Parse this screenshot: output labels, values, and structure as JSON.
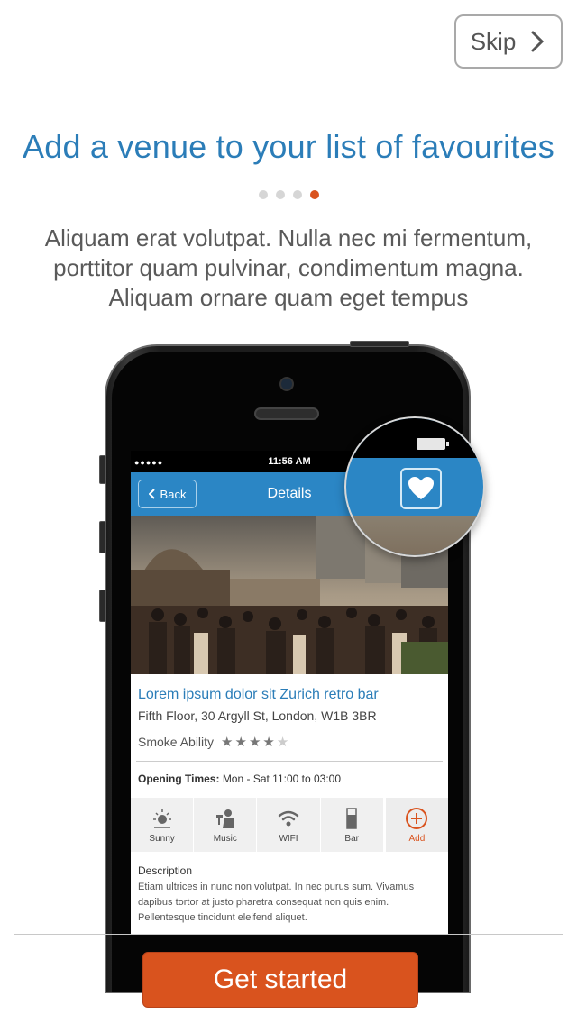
{
  "skip": {
    "label": "Skip"
  },
  "onboarding": {
    "title": "Add a venue to your list of favourites",
    "page_indicator": {
      "total": 4,
      "current": 4
    },
    "description": "Aliquam erat volutpat. Nulla nec mi fermentum, porttitor quam pulvinar, condimentum magna. Aliquam ornare quam eget tempus"
  },
  "phone_screen": {
    "status_bar": {
      "time": "11:56 AM",
      "signal": "●●●●●"
    },
    "nav": {
      "back_label": "Back",
      "title": "Details"
    },
    "venue": {
      "name": "Lorem ipsum dolor sit Zurich retro bar",
      "address": "Fifth Floor, 30 Argyll St, London, W1B 3BR",
      "smoke_label": "Smoke Ability",
      "smoke_rating": 4,
      "smoke_rating_max": 5,
      "opening_label": "Opening Times:",
      "opening_value": "Mon - Sat 11:00 to 03:00"
    },
    "amenities": [
      {
        "label": "Sunny",
        "icon": "sun-icon"
      },
      {
        "label": "Music",
        "icon": "music-icon"
      },
      {
        "label": "WIFI",
        "icon": "wifi-icon"
      },
      {
        "label": "Bar",
        "icon": "glass-icon"
      },
      {
        "label": "Add",
        "icon": "plus-circle-icon"
      }
    ],
    "description": {
      "label": "Description",
      "text": "Etiam ultrices in nunc non volutpat. In nec purus sum. Vivamus dapibus tortor at justo pharetra consequat non quis enim. Pellentesque tincidunt eleifend aliquet."
    }
  },
  "cta": {
    "label": "Get started"
  },
  "colors": {
    "accent": "#2b7db8",
    "nav_blue": "#2b86c5",
    "button_orange": "#d9531e"
  }
}
